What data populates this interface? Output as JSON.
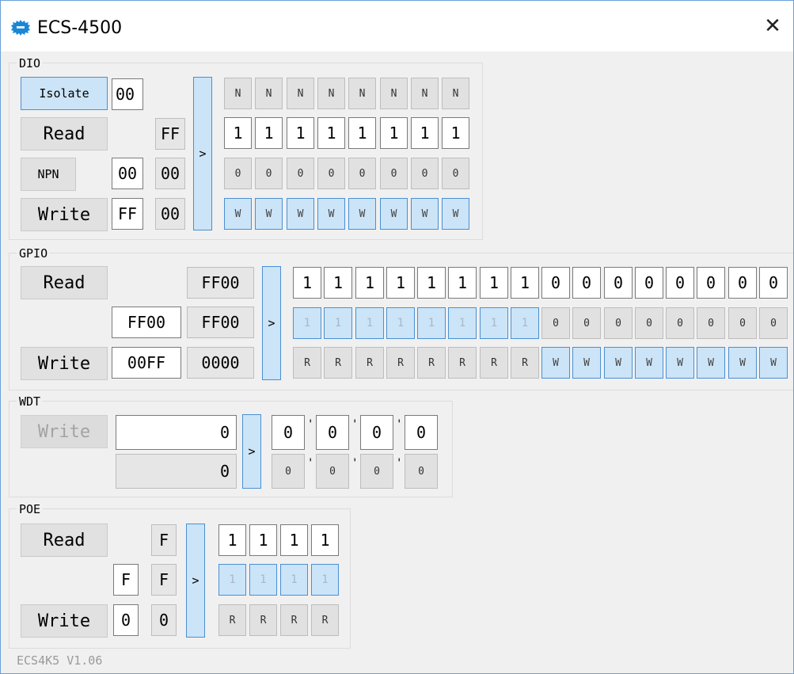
{
  "window": {
    "title": "ECS-4500",
    "close": "✕",
    "version": "ECS4K5 V1.06"
  },
  "dio": {
    "label": "DIO",
    "isolate": "Isolate",
    "isolate_value": "00",
    "read": "Read",
    "read_value": "FF",
    "npn": "NPN",
    "npn_value1": "00",
    "npn_value2": "00",
    "write": "Write",
    "write_value1": "FF",
    "write_value2": "00",
    "arrow": ">",
    "row1": [
      "N",
      "N",
      "N",
      "N",
      "N",
      "N",
      "N",
      "N"
    ],
    "row2": [
      "1",
      "1",
      "1",
      "1",
      "1",
      "1",
      "1",
      "1"
    ],
    "row3": [
      "0",
      "0",
      "0",
      "0",
      "0",
      "0",
      "0",
      "0"
    ],
    "row4": [
      "W",
      "W",
      "W",
      "W",
      "W",
      "W",
      "W",
      "W"
    ]
  },
  "gpio": {
    "label": "GPIO",
    "read": "Read",
    "read_value": "FF00",
    "mid_value1": "FF00",
    "mid_value2": "FF00",
    "write": "Write",
    "write_value1": "00FF",
    "write_value2": "0000",
    "arrow": ">",
    "row1": [
      "1",
      "1",
      "1",
      "1",
      "1",
      "1",
      "1",
      "1",
      "0",
      "0",
      "0",
      "0",
      "0",
      "0",
      "0",
      "0"
    ],
    "row2": [
      "1",
      "1",
      "1",
      "1",
      "1",
      "1",
      "1",
      "1",
      "0",
      "0",
      "0",
      "0",
      "0",
      "0",
      "0",
      "0"
    ],
    "row3": [
      "R",
      "R",
      "R",
      "R",
      "R",
      "R",
      "R",
      "R",
      "W",
      "W",
      "W",
      "W",
      "W",
      "W",
      "W",
      "W"
    ]
  },
  "wdt": {
    "label": "WDT",
    "write": "Write",
    "value1": "0",
    "value2": "0",
    "arrow": ">",
    "row1": [
      "0",
      "0",
      "0",
      "0"
    ],
    "row2": [
      "0",
      "0",
      "0",
      "0"
    ],
    "sep": "'"
  },
  "poe": {
    "label": "POE",
    "read": "Read",
    "read_value": "F",
    "mid_value1": "F",
    "mid_value2": "F",
    "write": "Write",
    "write_value1": "0",
    "write_value2": "0",
    "arrow": ">",
    "row1": [
      "1",
      "1",
      "1",
      "1"
    ],
    "row2": [
      "1",
      "1",
      "1",
      "1"
    ],
    "row3": [
      "R",
      "R",
      "R",
      "R"
    ]
  }
}
